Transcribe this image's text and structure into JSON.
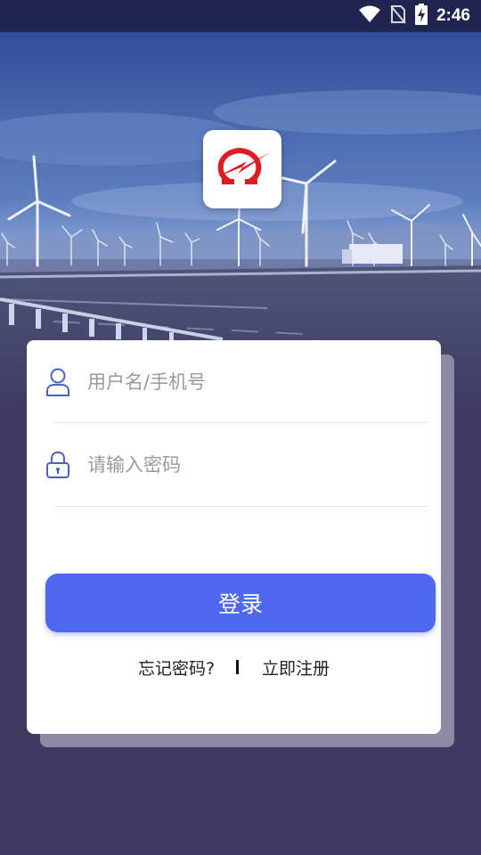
{
  "status_bar": {
    "time": "2:46",
    "icons": [
      "wifi-icon",
      "no-sim-icon",
      "battery-charging-icon"
    ]
  },
  "colors": {
    "status_bar_bg": "#1f2550",
    "page_bg": "#3f3b62",
    "accent": "#4f68f2",
    "logo_red": "#e11b22"
  },
  "logo": {
    "icon": "omega-lightning-logo"
  },
  "form": {
    "username": {
      "placeholder": "用户名/手机号",
      "value": "",
      "icon": "user-icon"
    },
    "password": {
      "placeholder": "请输入密码",
      "value": "",
      "icon": "lock-icon"
    },
    "login_label": "登录",
    "forgot_label": "忘记密码?",
    "register_label": "立即注册"
  }
}
